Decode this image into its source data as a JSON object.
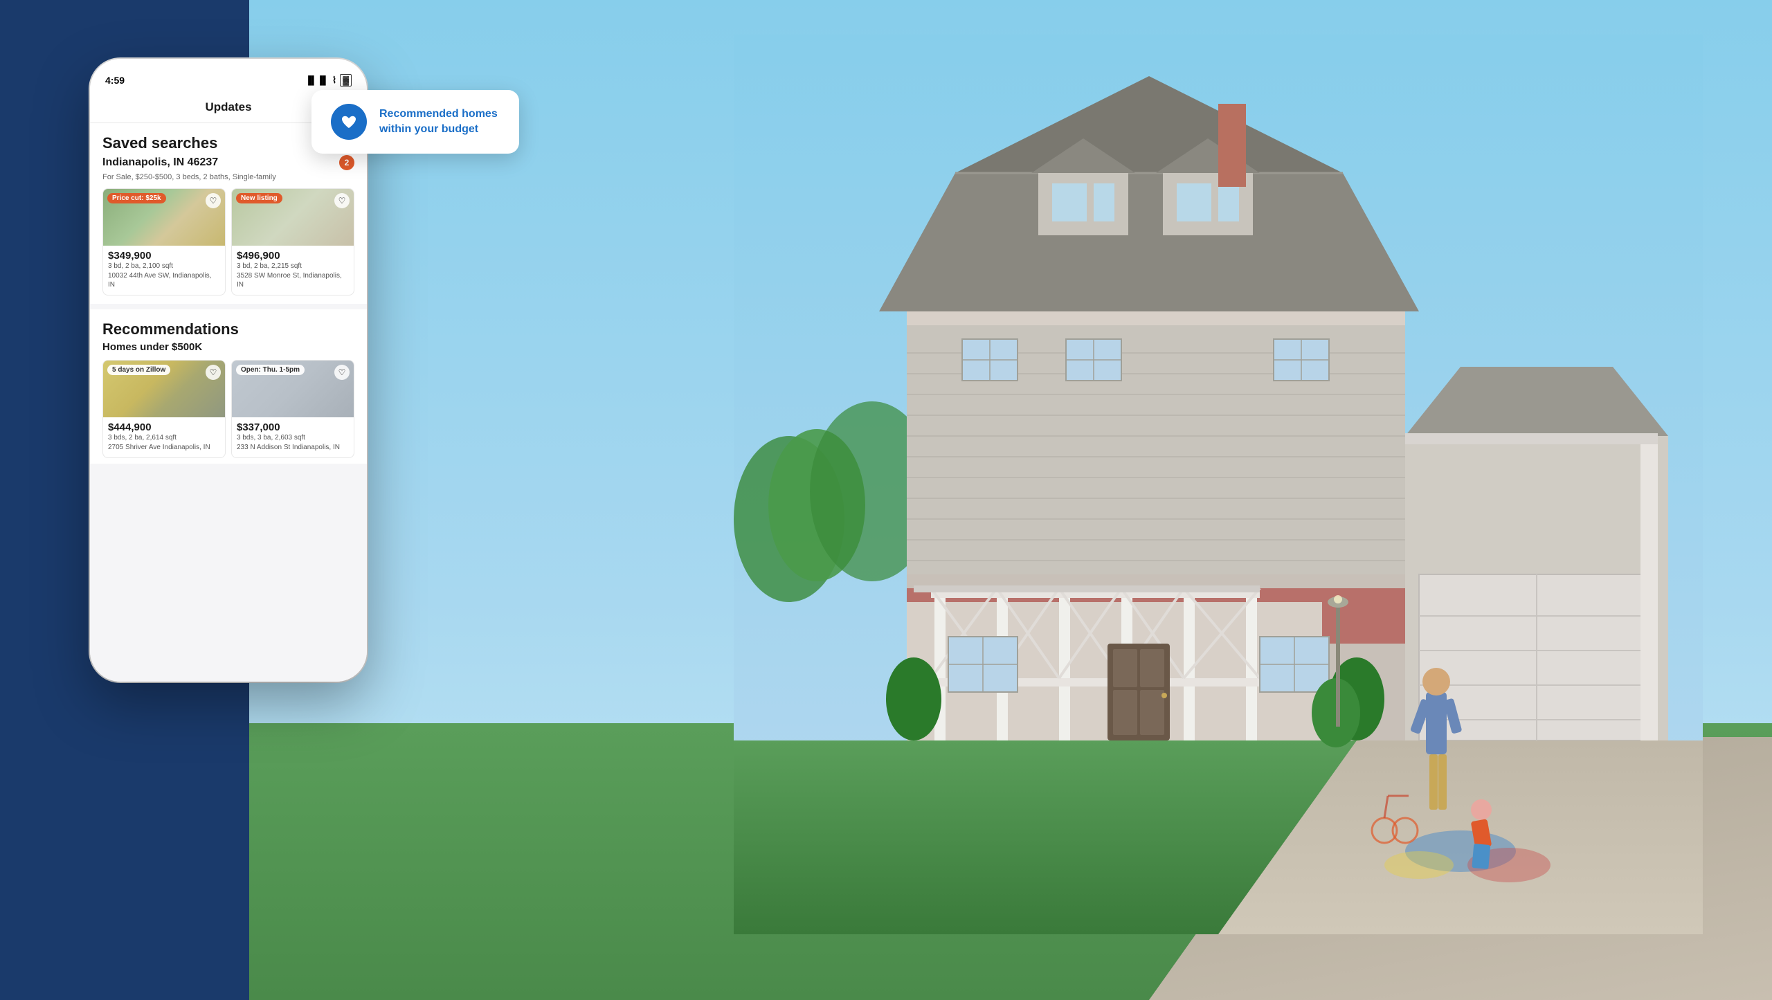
{
  "background": {
    "sky_color": "#87CEEB",
    "ground_color": "#5a9e5a"
  },
  "phone": {
    "status_bar": {
      "time": "4:59",
      "signal": "▐▐▐▐",
      "wifi": "WiFi",
      "battery": "🔋"
    },
    "header": "Updates",
    "saved_searches": {
      "section_title": "Saved searches",
      "search_title": "Indianapolis, IN 46237",
      "search_subtitle": "For Sale, $250-$500, 3 beds, 2 baths, Single-family",
      "badge_count": "2",
      "listing1": {
        "badge_label": "Price cut: $25k",
        "badge_type": "price-cut",
        "price": "$349,900",
        "details": "3 bd, 2 ba, 2,100 sqft",
        "address": "10032 44th Ave SW, Indianapolis, IN"
      },
      "listing2": {
        "badge_label": "New listing",
        "badge_type": "new-listing",
        "price": "$496,900",
        "details": "3 bd, 2 ba, 2,215 sqft",
        "address": "3528 SW Monroe St, Indianapolis, IN"
      }
    },
    "recommendations": {
      "section_title": "Recommendations",
      "subtitle": "Homes under $500K",
      "listing3": {
        "badge_label": "5 days on Zillow",
        "badge_type": "days",
        "price": "$444,900",
        "details": "3 bds, 2 ba, 2,614 sqft",
        "address": "2705 Shriver Ave\nIndianapolis, IN"
      },
      "listing4": {
        "badge_label": "Open: Thu. 1-5pm",
        "badge_type": "open",
        "price": "$337,000",
        "details": "3 bds, 3 ba, 2,603 sqft",
        "address": "233 N Addison St\nIndianapolis, IN"
      }
    }
  },
  "notification": {
    "text_line1": "Recommended homes",
    "text_line2": "within your budget",
    "full_text": "Recommended homes within your budget"
  },
  "colors": {
    "dark_blue": "#1a3a6b",
    "accent_blue": "#1a6ec7",
    "badge_orange": "#e05a2b",
    "white": "#ffffff"
  }
}
